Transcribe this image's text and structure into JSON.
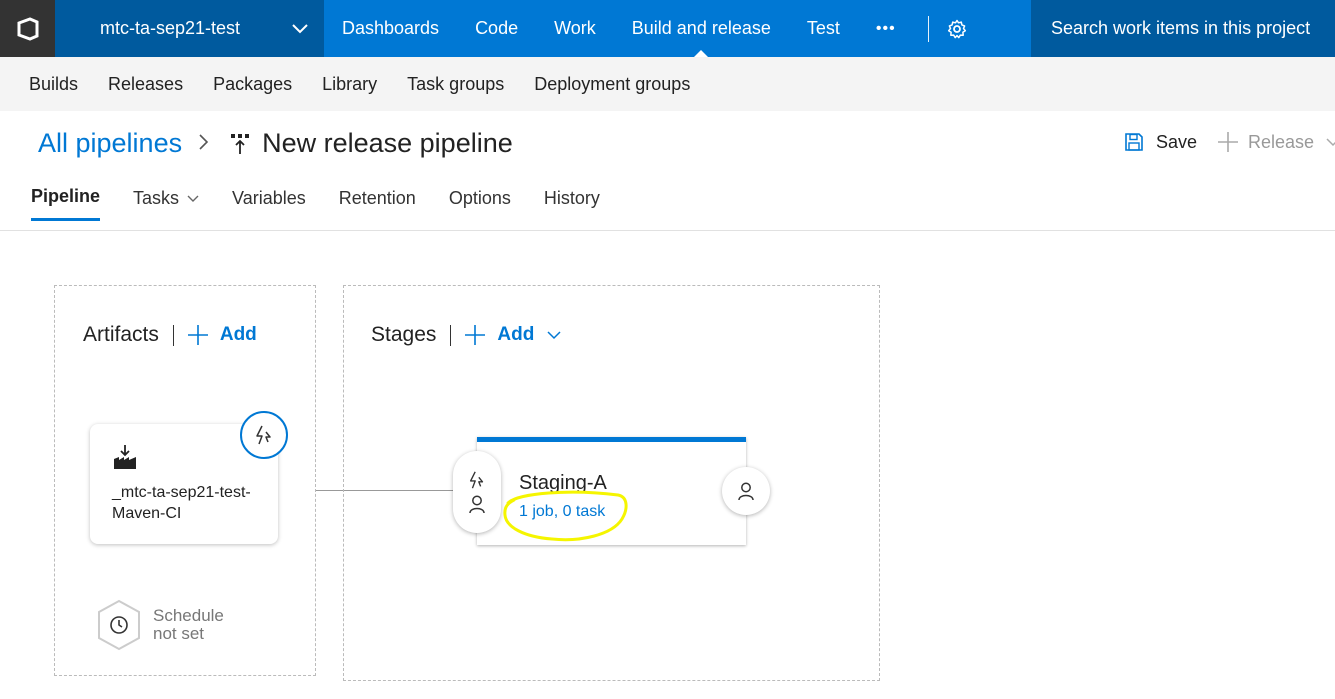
{
  "topbar": {
    "project_name": "mtc-ta-sep21-test",
    "nav_items": [
      "Dashboards",
      "Code",
      "Work",
      "Build and release",
      "Test"
    ],
    "more_label": "•••",
    "search_placeholder": "Search work items in this project"
  },
  "subnav": {
    "items": [
      "Builds",
      "Releases",
      "Packages",
      "Library",
      "Task groups",
      "Deployment groups"
    ]
  },
  "header": {
    "breadcrumb_link": "All pipelines",
    "title": "New release pipeline",
    "save_label": "Save",
    "release_label": "Release"
  },
  "tabs": [
    "Pipeline",
    "Tasks",
    "Variables",
    "Retention",
    "Options",
    "History"
  ],
  "artifacts": {
    "heading": "Artifacts",
    "add_label": "Add",
    "artifact_name": "_mtc-ta-sep21-test-Maven-CI",
    "schedule_line1": "Schedule",
    "schedule_line2": "not set"
  },
  "stages": {
    "heading": "Stages",
    "add_label": "Add",
    "stage_name": "Staging-A",
    "stage_summary": "1 job, 0 task"
  },
  "colors": {
    "accent": "#0078d4",
    "accent_dark": "#005a9e",
    "highlight": "#f5f500"
  }
}
